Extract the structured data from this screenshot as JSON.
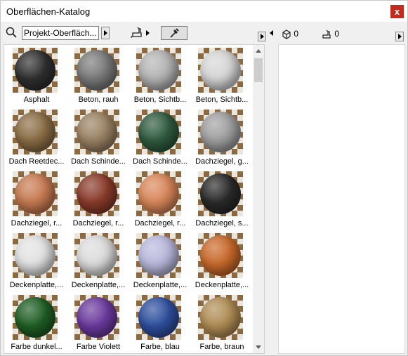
{
  "window": {
    "title": "Oberflächen-Katalog",
    "close_label": "x"
  },
  "toolbar": {
    "search_value": "Projekt-Oberfläch...",
    "search_icon": "search-icon",
    "bucket_icon": "paint-bucket-icon",
    "picker_icon": "eyedropper-icon"
  },
  "counters": {
    "objects": "0",
    "surfaces": "0"
  },
  "materials": [
    {
      "label": "Asphalt",
      "color": "#2f2f2f"
    },
    {
      "label": "Beton, rauh",
      "color": "#7a7a7a"
    },
    {
      "label": "Beton, Sichtb...",
      "color": "#b4b4b4"
    },
    {
      "label": "Beton, Sichtb...",
      "color": "#d6d6d6"
    },
    {
      "label": "Dach Reetdec...",
      "color": "#8a6d45"
    },
    {
      "label": "Dach Schinde...",
      "color": "#9a8264"
    },
    {
      "label": "Dach Schinde...",
      "color": "#2f5b3f"
    },
    {
      "label": "Dachziegel, g...",
      "color": "#a0a0a0"
    },
    {
      "label": "Dachziegel, r...",
      "color": "#c77a52"
    },
    {
      "label": "Dachziegel, r...",
      "color": "#8a3b2a"
    },
    {
      "label": "Dachziegel, r...",
      "color": "#d9875a"
    },
    {
      "label": "Dachziegel, s...",
      "color": "#2a2a2a"
    },
    {
      "label": "Deckenplatte,...",
      "color": "#e2e2e2"
    },
    {
      "label": "Deckenplatte,...",
      "color": "#dcdcdc"
    },
    {
      "label": "Deckenplatte,...",
      "color": "#b9b8dc"
    },
    {
      "label": "Deckenplatte,...",
      "color": "#c8692a"
    },
    {
      "label": "Farbe dunkel...",
      "color": "#1f5e24"
    },
    {
      "label": "Farbe Violett",
      "color": "#6b3a9e"
    },
    {
      "label": "Farbe, blau",
      "color": "#2e4f9e"
    },
    {
      "label": "Farbe, braun",
      "color": "#b08d55"
    }
  ],
  "colors": {
    "close": "#c42b1c",
    "tile_pattern": "#8b6a42"
  }
}
